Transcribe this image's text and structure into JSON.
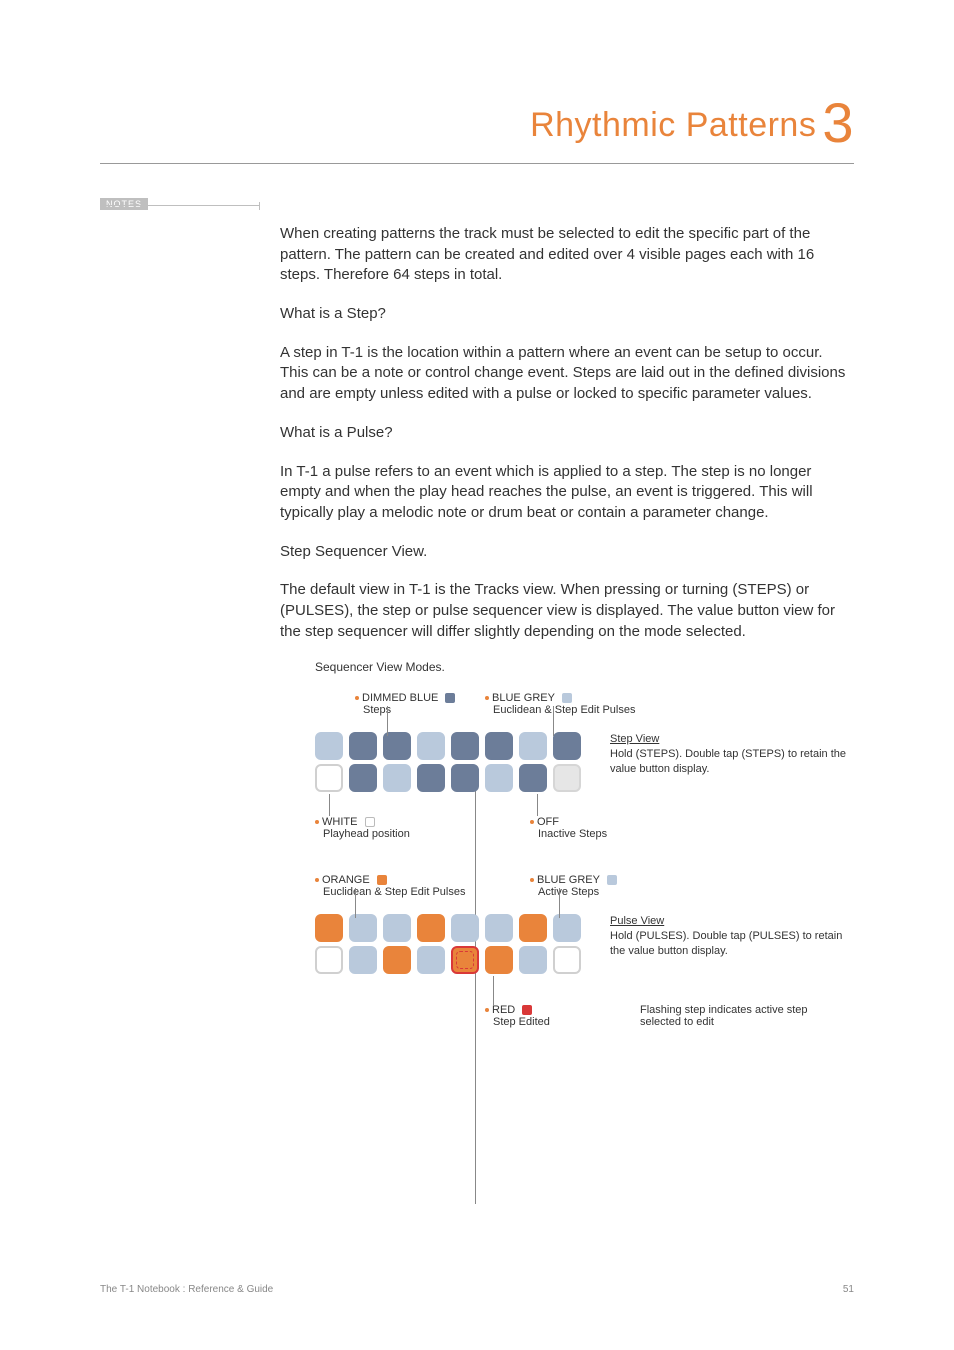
{
  "header": {
    "title": "Rhythmic Patterns",
    "chapter_number": "3"
  },
  "notes_label": "NOTES",
  "body": {
    "p1": "When creating patterns the track must be selected to edit the specific part of the pattern. The pattern can be created and edited over 4 visible pages each with 16 steps. Therefore 64 steps in total.",
    "h1": "What is a Step?",
    "p2": "A step in T-1 is the location within a pattern where an event can be setup to occur. This can be a note or control change event. Steps are laid out in the defined divisions and are empty unless edited with a pulse or locked to specific parameter values.",
    "h2": "What is a Pulse?",
    "p3": "In T-1 a pulse refers to an event which is applied to a step. The step is no longer empty and when the play head reaches the pulse, an event is triggered. This will typically play a melodic note or drum beat or contain a parameter change.",
    "h3": "Step Sequencer View.",
    "p4": "The default view in T-1 is the Tracks view. When pressing or turning (STEPS) or (PULSES), the step or pulse sequencer view is displayed. The value button view for the step sequencer will differ slightly depending on the mode selected."
  },
  "diagram": {
    "title": "Sequencer View Modes.",
    "legend_top_left": {
      "label": "DIMMED BLUE",
      "sub": "Steps"
    },
    "legend_top_right": {
      "label": "BLUE GREY",
      "sub": "Euclidean & Step Edit Pulses"
    },
    "step_view": {
      "title": "Step View",
      "text": "Hold (STEPS). Double tap (STEPS) to retain the value button display."
    },
    "legend_mid_left": {
      "label": "WHITE",
      "sub": "Playhead position"
    },
    "legend_mid_right": {
      "label": "OFF",
      "sub": "Inactive Steps"
    },
    "legend_bot_left": {
      "label": "ORANGE",
      "sub": "Euclidean & Step Edit Pulses"
    },
    "legend_bot_right": {
      "label": "BLUE GREY",
      "sub": "Active Steps"
    },
    "pulse_view": {
      "title": "Pulse View",
      "text": "Hold (PULSES). Double tap (PULSES) to retain the value button display."
    },
    "legend_red": {
      "label": "RED",
      "sub": "Step Edited"
    },
    "flash_note": "Flashing step indicates active step selected to edit"
  },
  "footer": {
    "book": "The T-1 Notebook : Reference & Guide",
    "page": "51"
  }
}
